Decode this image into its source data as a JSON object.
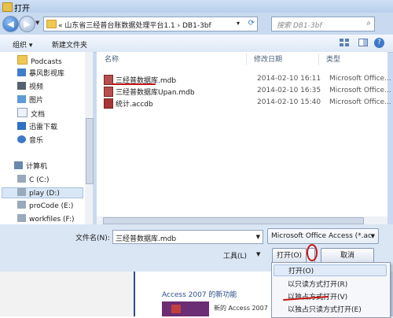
{
  "window": {
    "title": "打开"
  },
  "nav": {
    "path_text": "«  山东省三经普台账数据处理平台1.1  ›  DB1-3bf",
    "search_placeholder": "搜索 DB1-3bf"
  },
  "toolbar": {
    "organize": "组织 ▾",
    "new_folder": "新建文件夹"
  },
  "sidebar": {
    "items": [
      {
        "label": "Podcasts",
        "icon": "folder-icon"
      },
      {
        "label": "暴风影视库",
        "icon": "video-library-icon"
      },
      {
        "label": "视频",
        "icon": "video-icon"
      },
      {
        "label": "图片",
        "icon": "picture-icon"
      },
      {
        "label": "文档",
        "icon": "document-icon"
      },
      {
        "label": "迅雷下载",
        "icon": "thunder-download-icon"
      },
      {
        "label": "音乐",
        "icon": "music-icon"
      }
    ],
    "computer": "计算机",
    "drives": [
      {
        "label": "C (C:)"
      },
      {
        "label": "play (D:)"
      },
      {
        "label": "proCode (E:)"
      },
      {
        "label": "workfiles (F:)"
      }
    ]
  },
  "filelist": {
    "columns": [
      "名称",
      "修改日期",
      "类型"
    ],
    "rows": [
      {
        "name": "三经普数据库.mdb",
        "date": "2014-02-10 16:11",
        "type": "Microsoft Office..."
      },
      {
        "name": "三经普数据库Upan.mdb",
        "date": "2014-02-10 16:35",
        "type": "Microsoft Office..."
      },
      {
        "name": "统计.accdb",
        "date": "2014-02-10 15:40",
        "type": "Microsoft Office..."
      }
    ]
  },
  "bottom": {
    "filename_label": "文件名(N):",
    "filename_value": "三经普数据库.mdb",
    "filetype_value": "Microsoft Office Access (*.ac",
    "tools": "工具(L)",
    "open": "打开(O)",
    "cancel": "取消"
  },
  "open_menu": {
    "items": [
      "打开(O)",
      "以只读方式打开(R)",
      "以独占方式打开(V)",
      "以独占只读方式打开(E)"
    ]
  },
  "background": {
    "headline": "Access 2007 的新功能",
    "sub": "新的 Access 2007"
  }
}
